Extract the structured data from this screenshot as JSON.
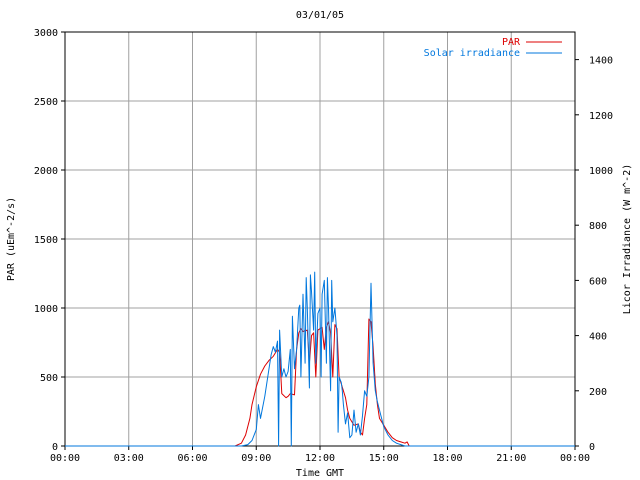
{
  "chart_data": {
    "type": "line",
    "title": "03/01/05",
    "xlabel": "Time GMT",
    "ylabel": "PAR (uEm^-2/s)",
    "y2label": "Licor Irradiance (W m^-2)",
    "x_ticks": [
      "00:00",
      "03:00",
      "06:00",
      "09:00",
      "12:00",
      "15:00",
      "18:00",
      "21:00",
      "00:00"
    ],
    "x_range_hours": [
      0,
      24
    ],
    "ylim": [
      0,
      3000
    ],
    "y_ticks": [
      0,
      500,
      1000,
      1500,
      2000,
      2500,
      3000
    ],
    "y2lim": [
      0,
      1500
    ],
    "y2_ticks": [
      0,
      200,
      400,
      600,
      800,
      1000,
      1200,
      1400
    ],
    "grid": true,
    "legend_position": "top-right",
    "series": [
      {
        "name": "PAR",
        "axis": "left",
        "color": "#dd0000",
        "x": [
          0,
          8.0,
          8.3,
          8.5,
          8.7,
          8.8,
          9.0,
          9.2,
          9.4,
          9.6,
          9.8,
          10.0,
          10.1,
          10.2,
          10.4,
          10.5,
          10.6,
          10.8,
          10.9,
          11.0,
          11.1,
          11.2,
          11.4,
          11.5,
          11.6,
          11.7,
          11.8,
          11.9,
          12.0,
          12.1,
          12.2,
          12.3,
          12.4,
          12.5,
          12.6,
          12.7,
          12.8,
          12.9,
          13.0,
          13.1,
          13.2,
          13.3,
          13.4,
          13.6,
          13.8,
          13.9,
          14.0,
          14.1,
          14.2,
          14.3,
          14.4,
          14.5,
          14.6,
          14.7,
          14.8,
          15.0,
          15.2,
          15.4,
          15.6,
          15.8,
          16.0,
          16.1,
          16.2,
          24
        ],
        "y": [
          0,
          0,
          20,
          80,
          200,
          300,
          430,
          520,
          580,
          620,
          650,
          700,
          680,
          380,
          350,
          360,
          380,
          370,
          700,
          820,
          850,
          830,
          840,
          600,
          800,
          820,
          500,
          840,
          850,
          860,
          700,
          860,
          900,
          820,
          500,
          880,
          850,
          500,
          450,
          400,
          350,
          260,
          200,
          150,
          160,
          100,
          80,
          200,
          300,
          920,
          900,
          720,
          450,
          300,
          200,
          150,
          100,
          60,
          40,
          30,
          20,
          30,
          0,
          0
        ]
      },
      {
        "name": "Solar irradiance",
        "axis": "right",
        "color": "#0077dd",
        "x": [
          0,
          8.3,
          8.6,
          8.8,
          9.0,
          9.1,
          9.2,
          9.4,
          9.5,
          9.6,
          9.7,
          9.8,
          9.9,
          10.0,
          10.05,
          10.1,
          10.2,
          10.3,
          10.4,
          10.5,
          10.6,
          10.65,
          10.7,
          10.8,
          10.9,
          11.0,
          11.05,
          11.1,
          11.2,
          11.3,
          11.35,
          11.4,
          11.5,
          11.55,
          11.6,
          11.7,
          11.75,
          11.8,
          11.9,
          12.0,
          12.05,
          12.1,
          12.2,
          12.3,
          12.35,
          12.4,
          12.5,
          12.55,
          12.6,
          12.7,
          12.8,
          12.85,
          12.9,
          13.0,
          13.05,
          13.1,
          13.2,
          13.3,
          13.4,
          13.5,
          13.6,
          13.7,
          13.8,
          13.9,
          14.0,
          14.1,
          14.2,
          14.3,
          14.4,
          14.5,
          14.6,
          14.7,
          14.8,
          14.9,
          15.0,
          15.2,
          15.4,
          15.6,
          15.8,
          16.0,
          24
        ],
        "y": [
          0,
          0,
          5,
          20,
          60,
          150,
          100,
          180,
          230,
          280,
          330,
          360,
          340,
          380,
          0,
          420,
          250,
          280,
          250,
          270,
          350,
          0,
          470,
          280,
          350,
          500,
          510,
          250,
          550,
          300,
          610,
          500,
          210,
          620,
          560,
          420,
          630,
          300,
          480,
          500,
          250,
          550,
          600,
          300,
          610,
          500,
          200,
          600,
          450,
          500,
          400,
          50,
          250,
          230,
          200,
          150,
          80,
          120,
          30,
          40,
          130,
          50,
          80,
          40,
          110,
          200,
          180,
          250,
          590,
          300,
          200,
          160,
          130,
          100,
          70,
          40,
          20,
          10,
          5,
          0,
          0
        ]
      }
    ]
  }
}
